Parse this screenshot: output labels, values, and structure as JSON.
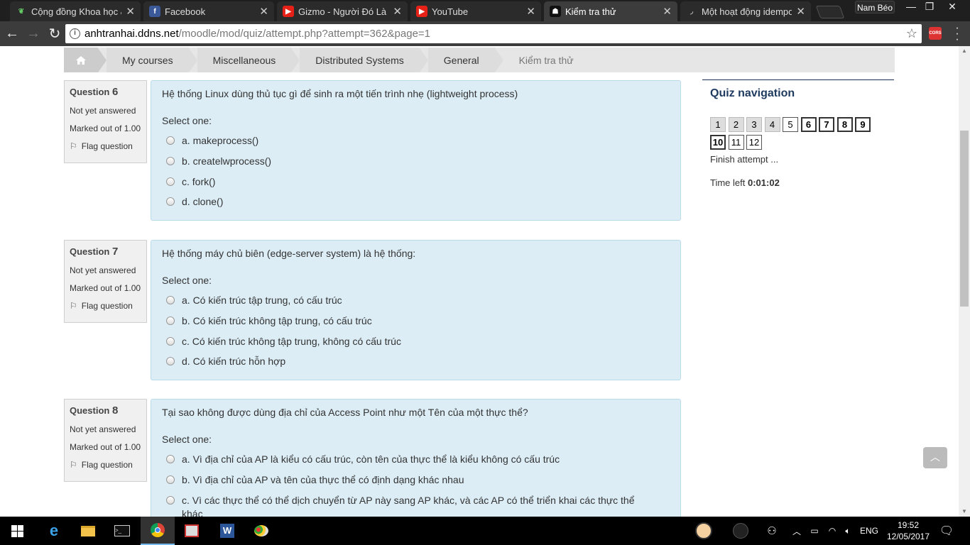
{
  "browser": {
    "tabs": [
      {
        "label": "Cộng đồng Khoa học &",
        "icon": "leaf-icon",
        "color": "#3a8f3a"
      },
      {
        "label": "Facebook",
        "icon": "facebook-icon",
        "color": "#3b5998"
      },
      {
        "label": "Gizmo - Người Đó Là Ai",
        "icon": "youtube-icon",
        "color": "#e62117"
      },
      {
        "label": "YouTube",
        "icon": "youtube-icon",
        "color": "#e62117"
      },
      {
        "label": "Kiểm tra thử",
        "icon": "moodle-icon",
        "color": "#222"
      },
      {
        "label": "Một hoạt động idempot",
        "icon": "page-icon",
        "color": "#888"
      }
    ],
    "profile": "Nam Béo",
    "url_host": "anhtranhai.ddns.net",
    "url_path": "/moodle/mod/quiz/attempt.php?attempt=362&page=1",
    "extension": "CORS"
  },
  "breadcrumb": {
    "items": [
      "My courses",
      "Miscellaneous",
      "Distributed Systems",
      "General"
    ],
    "current": "Kiểm tra thử"
  },
  "questions": [
    {
      "label": "Question",
      "number": "6",
      "state": "Not yet answered",
      "marks": "Marked out of 1.00",
      "flag": "Flag question",
      "text": "Hệ thống Linux dùng thủ tục gì để sinh ra một tiến trình nhẹ (lightweight process)",
      "prompt": "Select one:",
      "options": [
        "a. makeprocess()",
        "b. createlwprocess()",
        "c. fork()",
        "d. clone()"
      ]
    },
    {
      "label": "Question",
      "number": "7",
      "state": "Not yet answered",
      "marks": "Marked out of 1.00",
      "flag": "Flag question",
      "text": "Hệ thống máy chủ biên (edge-server system) là hệ thống:",
      "prompt": "Select one:",
      "options": [
        "a. Có kiến trúc tập trung, có cấu trúc",
        "b. Có kiến trúc không tập trung, có cấu trúc",
        "c. Có kiến trúc không tập trung, không có cấu trúc",
        "d. Có kiến trúc hỗn hợp"
      ]
    },
    {
      "label": "Question",
      "number": "8",
      "state": "Not yet answered",
      "marks": "Marked out of 1.00",
      "flag": "Flag question",
      "text": "Tại sao không được dùng địa chỉ của Access Point như một Tên của một thực thể?",
      "prompt": "Select one:",
      "options": [
        "a. Vì địa chỉ của AP là kiểu có cấu trúc, còn tên của thực thể là kiểu không có cấu trúc",
        "b. Vì địa chỉ của AP và tên của thực thể có định dạng khác nhau",
        "c. Vì các thực thể có thể dịch chuyển từ AP này sang AP khác, và các AP có thể triển khai các thực thể khác"
      ]
    }
  ],
  "quiz_nav": {
    "title": "Quiz navigation",
    "buttons": [
      {
        "label": "1",
        "status": "answered"
      },
      {
        "label": "2",
        "status": "answered"
      },
      {
        "label": "3",
        "status": "answered"
      },
      {
        "label": "4",
        "status": "answered"
      },
      {
        "label": "5",
        "status": "unanswered"
      },
      {
        "label": "6",
        "status": "current"
      },
      {
        "label": "7",
        "status": "current"
      },
      {
        "label": "8",
        "status": "current"
      },
      {
        "label": "9",
        "status": "current"
      },
      {
        "label": "10",
        "status": "current"
      },
      {
        "label": "11",
        "status": "unanswered"
      },
      {
        "label": "12",
        "status": "unanswered"
      }
    ],
    "finish": "Finish attempt ...",
    "time_label": "Time left",
    "time_value": "0:01:02"
  },
  "taskbar": {
    "language": "ENG",
    "time": "19:52",
    "date": "12/05/2017"
  }
}
